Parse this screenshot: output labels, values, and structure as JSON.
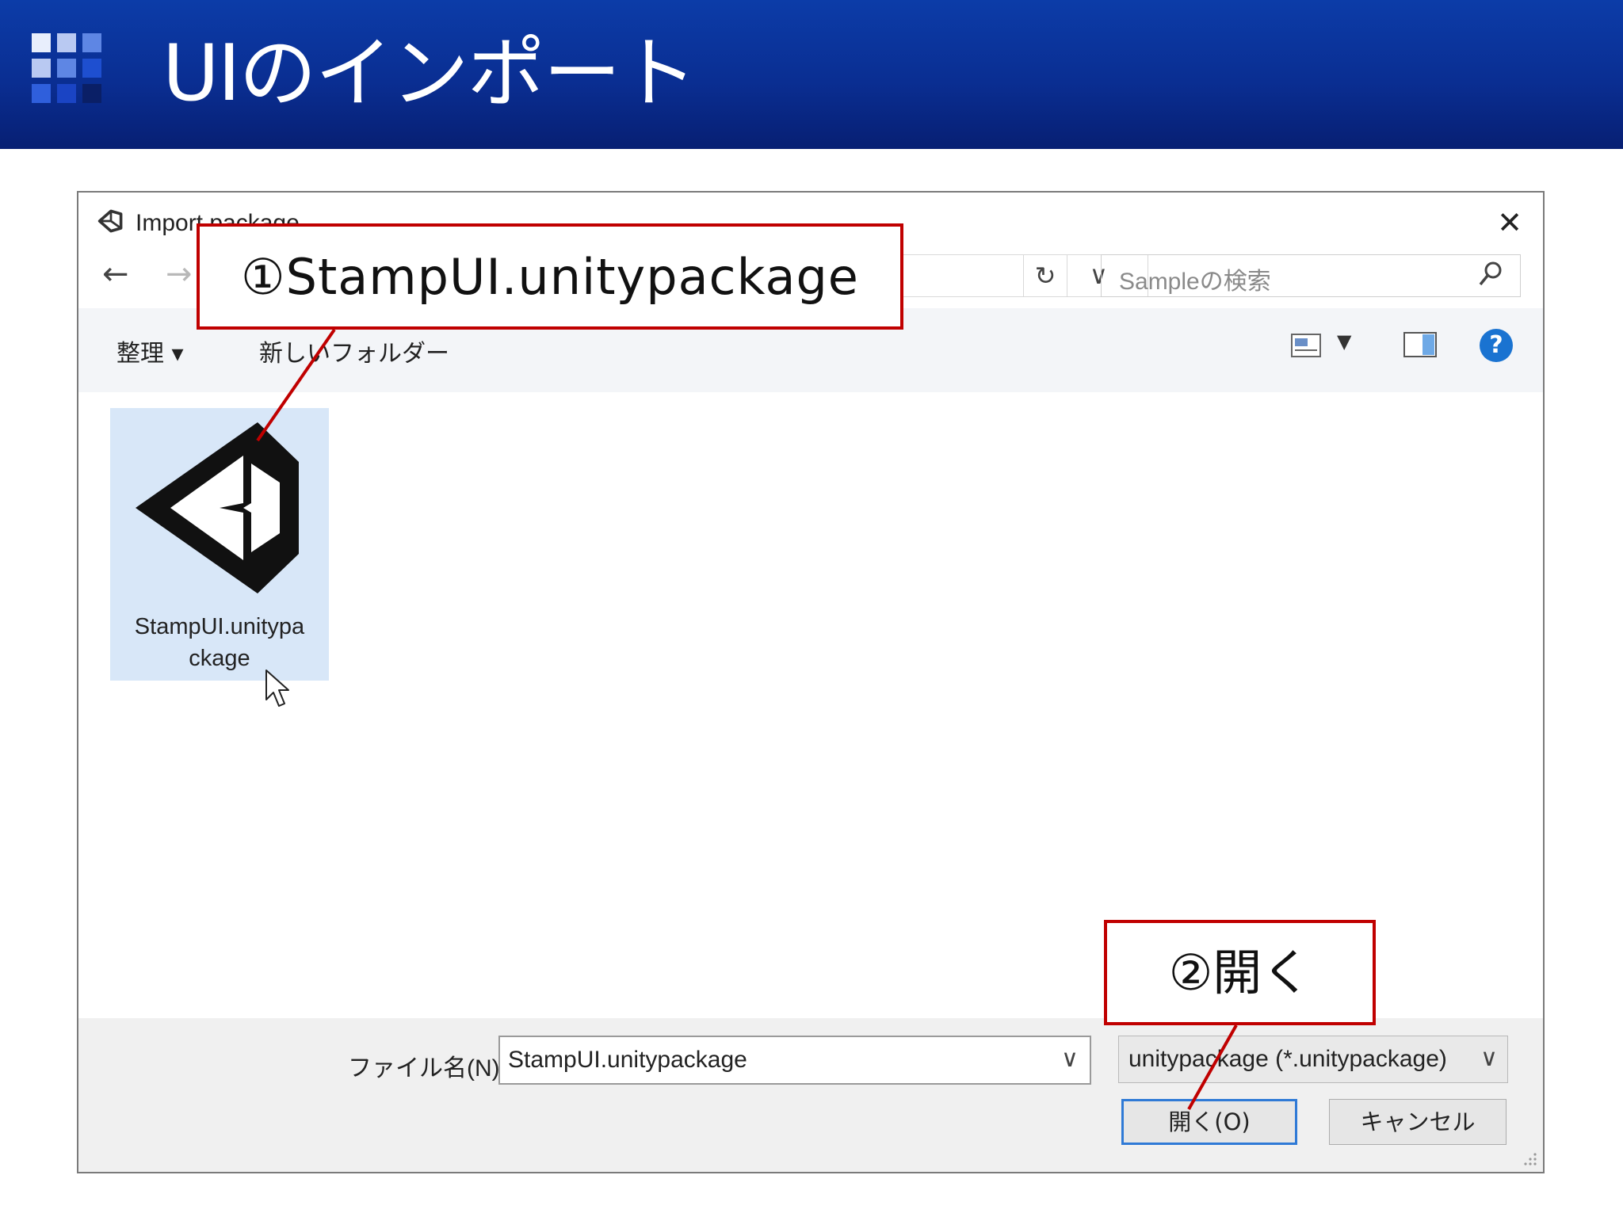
{
  "slide": {
    "title": "UIのインポート"
  },
  "dialog": {
    "title": "Import package",
    "close_glyph": "✕",
    "nav": {
      "back_glyph": "←",
      "forward_glyph": "→",
      "dropdown_glyph": "∨",
      "refresh_glyph": "↻",
      "search_placeholder": "Sampleの検索"
    },
    "toolbar": {
      "organize_label": "整理 ▾",
      "new_folder_label": "新しいフォルダー",
      "view_dropdown_glyph": "▼",
      "help_glyph": "?"
    },
    "file": {
      "name_line1": "StampUI.unitypa",
      "name_line2": "ckage"
    },
    "bottom": {
      "filename_label": "ファイル名(N):",
      "filename_value": "StampUI.unitypackage",
      "filename_dropdown_glyph": "∨",
      "filter_value": "unitypackage (*.unitypackage)",
      "filter_dropdown_glyph": "∨",
      "open_label": "開く(O)",
      "cancel_label": "キャンセル"
    }
  },
  "callouts": {
    "step1": "①StampUI.unitypackage",
    "step2": "②開く"
  },
  "colors": {
    "header_blue": "#0a2e92",
    "callout_red": "#c00000",
    "selection_blue": "#d8e7f8",
    "open_button_border": "#2f7ad6",
    "help_icon": "#1a73d1"
  },
  "icons": {
    "logo": "blue-grid-icon",
    "dialog_app": "unity-icon",
    "search": "magnifier-icon",
    "file": "unity-package-icon",
    "cursor": "mouse-pointer-icon"
  }
}
